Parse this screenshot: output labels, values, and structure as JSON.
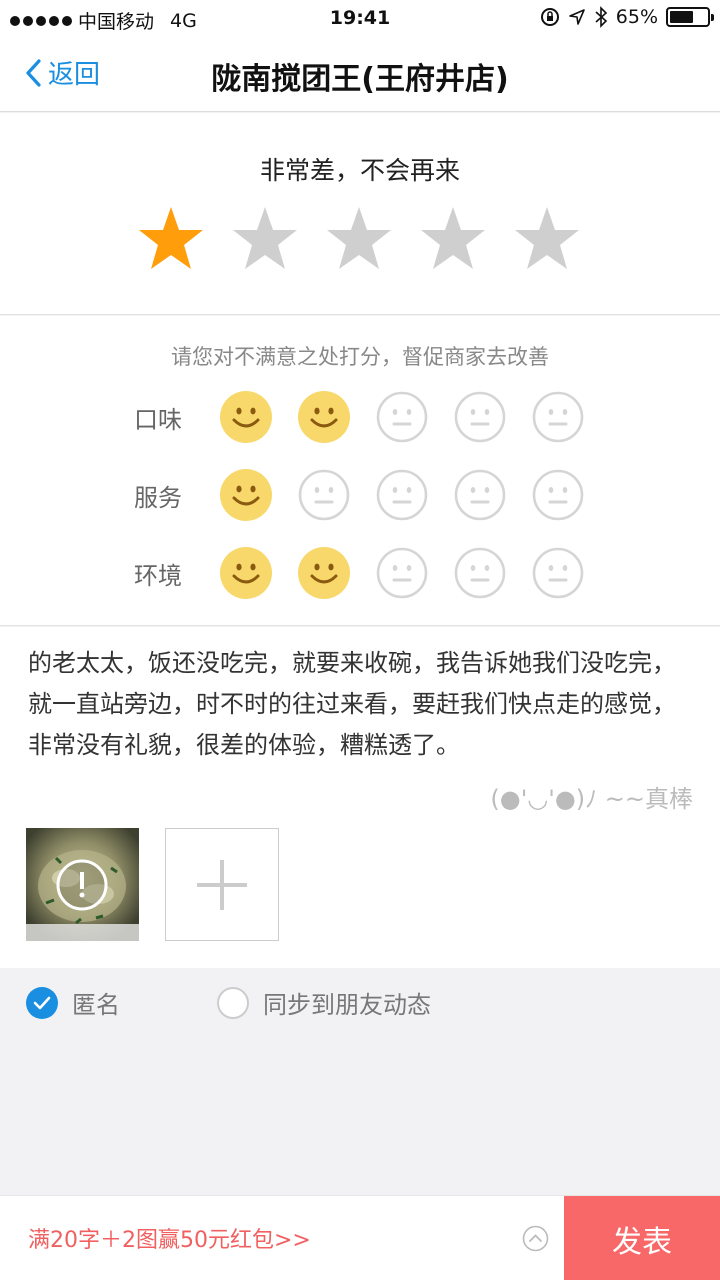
{
  "status_bar": {
    "carrier": "中国移动",
    "network": "4G",
    "time": "19:41",
    "battery_pct": "65%",
    "battery_level": 0.65,
    "icons": [
      "signal-dots-icon",
      "lock-rotation-icon",
      "location-icon",
      "bluetooth-icon",
      "battery-icon"
    ]
  },
  "nav": {
    "back_label": "返回",
    "title": "陇南搅团王(王府井店)"
  },
  "rating": {
    "text": "非常差，不会再来",
    "stars_total": 5,
    "stars_selected": 1,
    "star_active_color": "#ff9d0b",
    "star_inactive_color": "#cfcfcf"
  },
  "sub_ratings": {
    "hint": "请您对不满意之处打分，督促商家去改善",
    "rows": [
      {
        "label": "口味",
        "score": 2
      },
      {
        "label": "服务",
        "score": 1
      },
      {
        "label": "环境",
        "score": 2
      }
    ],
    "faces_total": 5,
    "face_active_color": "#f8d86a",
    "face_inactive_color": "#d5d5d5"
  },
  "comment": {
    "text": "的老太太，饭还没吃完，就要来收碗，我告诉她我们没吃完，就一直站旁边，时不时的往过来看，要赶我们快点走的感觉，非常没有礼貌，很差的体验，糟糕透了。",
    "kaomoji": "(●'◡'●)ﾉ ~~真棒"
  },
  "photos": {
    "thumb_icon": "warning-icon",
    "add_icon": "plus-icon"
  },
  "options": {
    "anonymous_label": "匿名",
    "anonymous_checked": true,
    "sync_label": "同步到朋友动态",
    "sync_checked": false
  },
  "bottom": {
    "promo": "满20字＋2图赢50元红包>>",
    "submit_label": "发表"
  }
}
